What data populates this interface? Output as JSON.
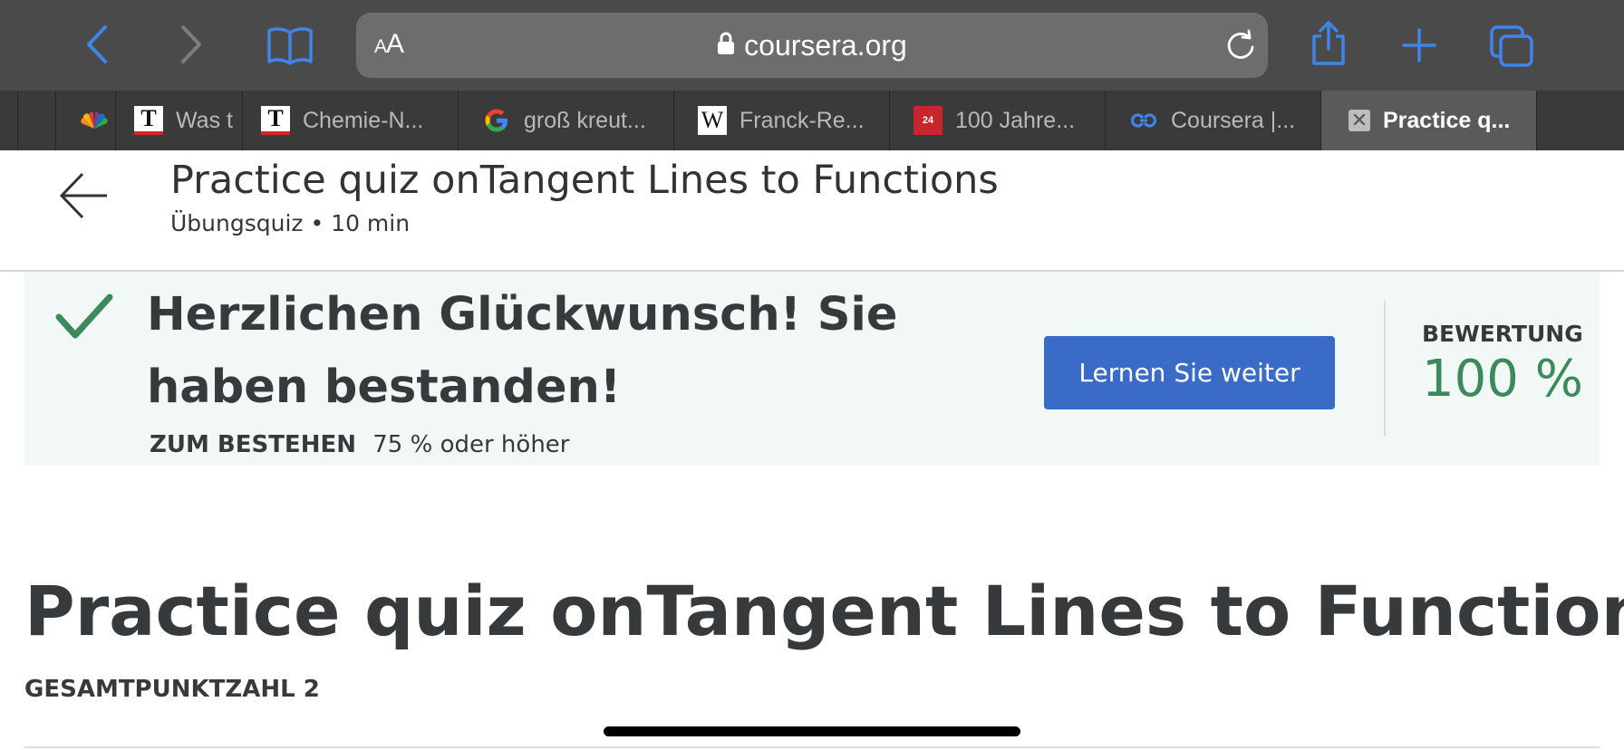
{
  "browser": {
    "address": {
      "aa_small": "A",
      "aa_large": "A",
      "url": "coursera.org"
    },
    "tabs": [
      {
        "icon": "nbc-peacock-icon",
        "label": ""
      },
      {
        "icon": "t-online-icon",
        "label": "Was t"
      },
      {
        "icon": "t-online-icon",
        "label": "Chemie-N..."
      },
      {
        "icon": "google-icon",
        "label": "groß kreut..."
      },
      {
        "icon": "wikipedia-icon",
        "label": "Franck-Re..."
      },
      {
        "icon": "news-24-icon",
        "label": "100 Jahre..."
      },
      {
        "icon": "coursera-icon",
        "label": "Coursera |..."
      },
      {
        "icon": "close-tab-icon",
        "label": "Practice q..."
      }
    ],
    "favicon_text": {
      "t": "T",
      "w": "W",
      "n24": "24",
      "x": "✕"
    },
    "colors": {
      "accent": "#3f84e6",
      "toolbar": "#4a4a4b"
    }
  },
  "header": {
    "title": "Practice quiz onTangent Lines to Functions",
    "subtitle": "Übungsquiz • 10 min"
  },
  "result": {
    "message": "Herzlichen Glückwunsch! Sie haben bestanden!",
    "pass_label": "ZUM BESTEHEN",
    "pass_value": "75 % oder höher",
    "continue_button": "Lernen Sie weiter",
    "grade_label": "BEWERTUNG",
    "grade_value": "100 %",
    "colors": {
      "banner_bg": "#f1f8f5",
      "success": "#3b8a5c",
      "button": "#3a6cc7"
    }
  },
  "main": {
    "title": "Practice quiz onTangent Lines to Functions",
    "total_points": "GESAMTPUNKTZAHL 2"
  }
}
